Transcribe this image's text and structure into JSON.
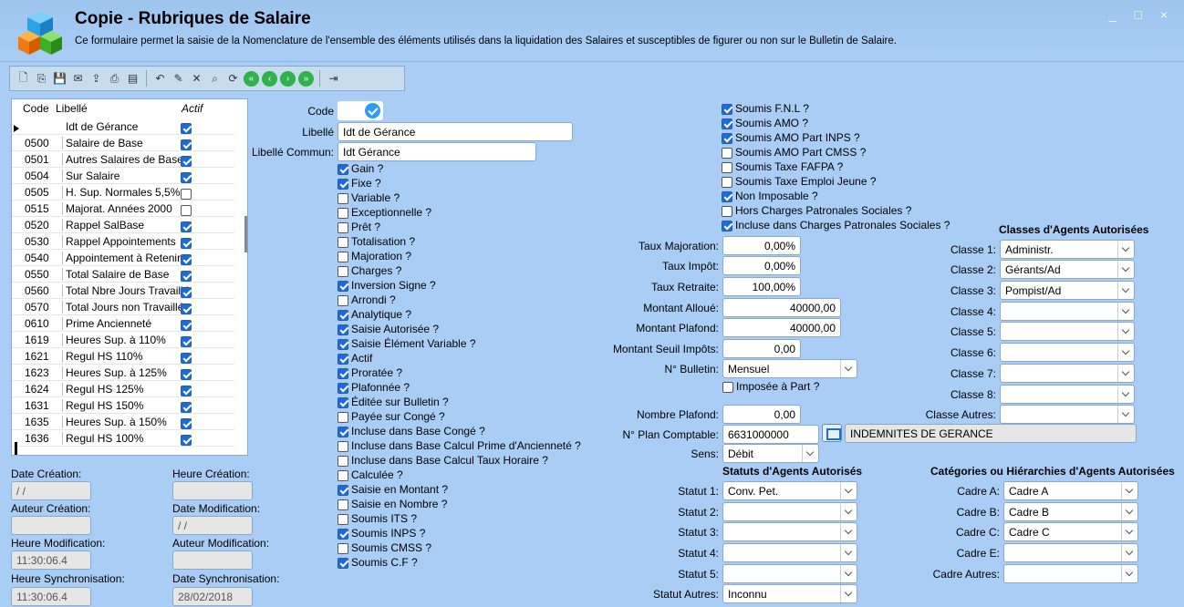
{
  "window": {
    "title": "Copie - Rubriques de Salaire",
    "subtitle": "Ce formulaire permet la saisie de la Nomenclature de l'ensemble des éléments utilisés dans la liquidation des Salaires et susceptibles de figurer ou non sur le Bulletin de Salaire.",
    "controls": "_ □ ×"
  },
  "toolbar": {
    "icons": [
      "new-icon",
      "copy-icon",
      "save-icon",
      "mail-icon",
      "export-icon",
      "print-icon",
      "preview-icon",
      "undo-icon",
      "edit-icon",
      "delete-icon",
      "search-icon",
      "refresh-icon",
      "first-icon",
      "previous-icon",
      "next-icon",
      "last-icon",
      "exit-icon"
    ]
  },
  "list": {
    "headers": {
      "code": "Code",
      "libelle": "Libellé",
      "actif": "Actif"
    },
    "rows": [
      {
        "code": "",
        "libelle": "Idt de Gérance",
        "actif": true
      },
      {
        "code": "0500",
        "libelle": "Salaire de Base",
        "actif": true
      },
      {
        "code": "0501",
        "libelle": "Autres Salaires de Base",
        "actif": true
      },
      {
        "code": "0504",
        "libelle": "Sur Salaire",
        "actif": true
      },
      {
        "code": "0505",
        "libelle": "H. Sup. Normales 5,5%",
        "actif": false
      },
      {
        "code": "0515",
        "libelle": "Majorat. Années 2000",
        "actif": false
      },
      {
        "code": "0520",
        "libelle": "Rappel SalBase",
        "actif": true
      },
      {
        "code": "0530",
        "libelle": "Rappel Appointements",
        "actif": true
      },
      {
        "code": "0540",
        "libelle": "Appointement à Retenir",
        "actif": true
      },
      {
        "code": "0550",
        "libelle": "Total Salaire de Base",
        "actif": true
      },
      {
        "code": "0560",
        "libelle": "Total Nbre Jours Travaillés",
        "actif": true
      },
      {
        "code": "0570",
        "libelle": "Total  Jours non Travaillés",
        "actif": true
      },
      {
        "code": "0610",
        "libelle": "Prime Ancienneté",
        "actif": true
      },
      {
        "code": "1619",
        "libelle": "Heures Sup. à 110%",
        "actif": true
      },
      {
        "code": "1621",
        "libelle": "Regul HS 110%",
        "actif": true
      },
      {
        "code": "1623",
        "libelle": "Heures Sup. à 125%",
        "actif": true
      },
      {
        "code": "1624",
        "libelle": "Regul HS 125%",
        "actif": true
      },
      {
        "code": "1631",
        "libelle": "Regul HS 150%",
        "actif": true
      },
      {
        "code": "1635",
        "libelle": "Heures Sup. à 150%",
        "actif": true
      },
      {
        "code": "1636",
        "libelle": "Regul HS 100%",
        "actif": true
      }
    ]
  },
  "meta": {
    "date_creation_label": "Date Création:",
    "date_creation": " / /",
    "heure_creation_label": "Heure Création:",
    "heure_creation": "",
    "auteur_creation_label": "Auteur Création:",
    "auteur_creation": "",
    "date_modification_label": "Date Modification:",
    "date_modification": " / /",
    "heure_modification_label": "Heure Modification:",
    "heure_modification": "11:30:06.4",
    "auteur_modification_label": "Auteur Modification:",
    "auteur_modification": "",
    "heure_sync_label": "Heure Synchronisation:",
    "heure_sync": "11:30:06.4",
    "date_sync_label": "Date Synchronisation:",
    "date_sync": "28/02/2018"
  },
  "form": {
    "code_label": "Code",
    "libelle_label": "Libellé",
    "libelle": "Idt de Gérance",
    "libelle_commun_label": "Libellé Commun:",
    "libelle_commun": "Idt Gérance",
    "checks_left": [
      {
        "label": "Gain ?",
        "checked": true
      },
      {
        "label": "Fixe ?",
        "checked": true
      },
      {
        "label": "Variable ?",
        "checked": false
      },
      {
        "label": "Exceptionnelle ?",
        "checked": false
      },
      {
        "label": "Prêt ?",
        "checked": false
      },
      {
        "label": "Totalisation ?",
        "checked": false
      },
      {
        "label": "Majoration ?",
        "checked": false
      },
      {
        "label": "Charges ?",
        "checked": false
      },
      {
        "label": "Inversion Signe ?",
        "checked": true
      },
      {
        "label": "Arrondi ?",
        "checked": false
      },
      {
        "label": "Analytique ?",
        "checked": true
      },
      {
        "label": "Saisie Autorisée ?",
        "checked": true
      },
      {
        "label": "Saisie Élément Variable ?",
        "checked": true
      },
      {
        "label": "Actif",
        "checked": true
      },
      {
        "label": "Proratée ?",
        "checked": true
      },
      {
        "label": "Plafonnée ?",
        "checked": true
      },
      {
        "label": "Éditée sur Bulletin ?",
        "checked": true
      },
      {
        "label": "Payée sur Congé ?",
        "checked": false
      },
      {
        "label": "Incluse dans Base Congé ?",
        "checked": true
      },
      {
        "label": "Incluse dans Base Calcul Prime d'Ancienneté ?",
        "checked": false
      },
      {
        "label": "Incluse dans Base Calcul Taux Horaire ?",
        "checked": false
      },
      {
        "label": "Calculée ?",
        "checked": false
      },
      {
        "label": "Saisie en Montant ?",
        "checked": true
      },
      {
        "label": "Saisie en Nombre ?",
        "checked": false
      },
      {
        "label": "Soumis ITS ?",
        "checked": false
      },
      {
        "label": "Soumis INPS ?",
        "checked": true
      },
      {
        "label": "Soumis CMSS ?",
        "checked": false
      },
      {
        "label": "Soumis C.F ?",
        "checked": true
      }
    ],
    "checks_right": [
      {
        "label": "Soumis F.N.L ?",
        "checked": true
      },
      {
        "label": "Soumis AMO ?",
        "checked": true
      },
      {
        "label": "Soumis AMO Part INPS ?",
        "checked": true
      },
      {
        "label": "Soumis AMO Part CMSS ?",
        "checked": false
      },
      {
        "label": "Soumis Taxe FAFPA ?",
        "checked": false
      },
      {
        "label": "Soumis Taxe Emploi Jeune ?",
        "checked": false
      },
      {
        "label": "Non Imposable ?",
        "checked": true
      },
      {
        "label": "Hors Charges Patronales Sociales ?",
        "checked": false
      },
      {
        "label": "Incluse dans Charges Patronales Sociales ?",
        "checked": true
      }
    ],
    "taux_majoration_label": "Taux Majoration:",
    "taux_majoration": "0,00%",
    "taux_impot_label": "Taux Impôt:",
    "taux_impot": "0,00%",
    "taux_retraite_label": "Taux Retraite:",
    "taux_retraite": "100,00%",
    "montant_alloue_label": "Montant Alloué:",
    "montant_alloue": "40000,00",
    "montant_plafond_label": "Montant Plafond:",
    "montant_plafond": "40000,00",
    "montant_seuil_label": "Montant Seuil Impôts:",
    "montant_seuil": "0,00",
    "bulletin_label": "N° Bulletin:",
    "bulletin": "Mensuel",
    "imposee_label": "Imposée à Part ?",
    "imposee": false,
    "nombre_plafond_label": "Nombre Plafond:",
    "nombre_plafond": "0,00",
    "plan_comptable_label": "N° Plan Comptable:",
    "plan_comptable": "6631000000",
    "plan_comptable_desc": "INDEMNITES DE GERANCE",
    "sens_label": "Sens:",
    "sens": "Débit"
  },
  "classes": {
    "title": "Classes d'Agents Autorisées",
    "items": [
      {
        "label": "Classe 1:",
        "value": "Administr."
      },
      {
        "label": "Classe 2:",
        "value": "Gérants/Ad"
      },
      {
        "label": "Classe 3:",
        "value": "Pompist/Ad"
      },
      {
        "label": "Classe 4:",
        "value": ""
      },
      {
        "label": "Classe 5:",
        "value": ""
      },
      {
        "label": "Classe 6:",
        "value": ""
      },
      {
        "label": "Classe 7:",
        "value": ""
      },
      {
        "label": "Classe 8:",
        "value": ""
      },
      {
        "label": "Classe Autres:",
        "value": ""
      }
    ]
  },
  "statuts": {
    "title": "Statuts d'Agents Autorisés",
    "items": [
      {
        "label": "Statut 1:",
        "value": "Conv. Pet."
      },
      {
        "label": "Statut 2:",
        "value": ""
      },
      {
        "label": "Statut 3:",
        "value": ""
      },
      {
        "label": "Statut 4:",
        "value": ""
      },
      {
        "label": "Statut 5:",
        "value": ""
      },
      {
        "label": "Statut Autres:",
        "value": "Inconnu"
      }
    ]
  },
  "cadres": {
    "title": "Catégories ou Hiérarchies d'Agents Autorisées",
    "items": [
      {
        "label": "Cadre A:",
        "value": "Cadre A"
      },
      {
        "label": "Cadre B:",
        "value": "Cadre B"
      },
      {
        "label": "Cadre C:",
        "value": "Cadre C"
      },
      {
        "label": "Cadre E:",
        "value": ""
      },
      {
        "label": "Cadre Autres:",
        "value": ""
      }
    ]
  }
}
